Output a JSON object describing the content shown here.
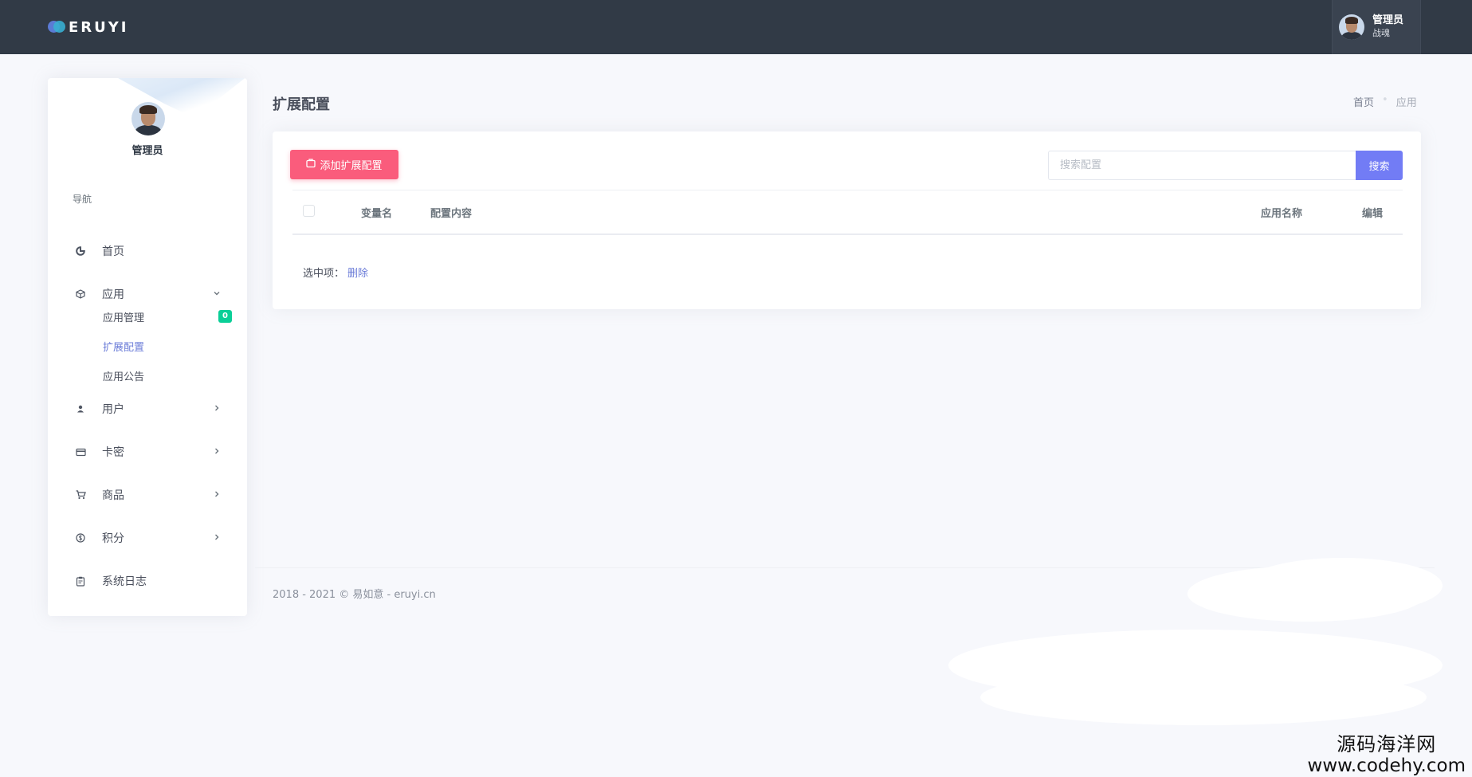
{
  "topbar": {
    "logo_text": "ERUYI",
    "user_name": "管理员",
    "user_role": "战魂"
  },
  "sidebar": {
    "username": "管理员",
    "nav_title": "导航",
    "items": [
      {
        "label": "首页",
        "icon": "dashboard-icon"
      },
      {
        "label": "应用",
        "icon": "cube-icon",
        "expanded": true
      },
      {
        "label": "用户",
        "icon": "user-icon"
      },
      {
        "label": "卡密",
        "icon": "card-icon"
      },
      {
        "label": "商品",
        "icon": "cart-icon"
      },
      {
        "label": "积分",
        "icon": "coin-icon"
      },
      {
        "label": "系统日志",
        "icon": "clipboard-icon"
      }
    ],
    "sub_items": [
      {
        "label": "应用管理",
        "badge": "0"
      },
      {
        "label": "扩展配置",
        "active": true
      },
      {
        "label": "应用公告"
      }
    ]
  },
  "page": {
    "title": "扩展配置",
    "breadcrumb": {
      "home": "首页",
      "current": "应用"
    }
  },
  "toolbar": {
    "add_label": "添加扩展配置",
    "search_placeholder": "搜索配置",
    "search_label": "搜索"
  },
  "table": {
    "columns": [
      "变量名",
      "配置内容",
      "应用名称",
      "编辑"
    ]
  },
  "selection": {
    "label": "选中项：",
    "delete_label": "删除"
  },
  "footer": {
    "text": "2018 - 2021 © 易如意 - eruyi.cn"
  },
  "watermark": {
    "line1": "源码海洋网",
    "line2": "www.codehy.com"
  },
  "colors": {
    "topbar": "#313a46",
    "primary": "#727cf5",
    "danger": "#fa5c7c",
    "success": "#0acf97",
    "link": "#6c7dd8"
  }
}
